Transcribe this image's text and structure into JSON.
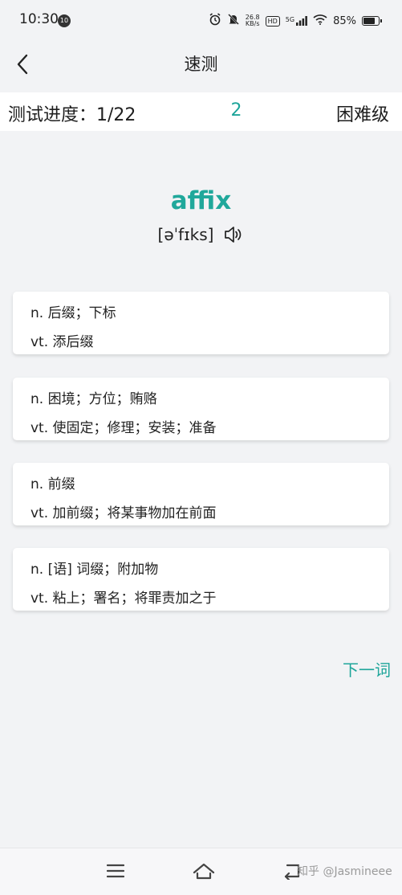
{
  "status_bar": {
    "time": "10:30",
    "notification_badge": "10",
    "net_speed_value": "26.8",
    "net_speed_unit": "KB/s",
    "hd_label": "HD",
    "network_label": "5G",
    "battery": "85%",
    "battery_level": 0.85
  },
  "header": {
    "title": "速测"
  },
  "progress": {
    "label": "测试进度：1/22",
    "correct_count": "2",
    "difficulty": "困难级"
  },
  "word": {
    "text": "affix",
    "phonetic": "[əˈfɪks]"
  },
  "options": [
    {
      "line1": "n. 后缀；下标",
      "line2": "vt. 添后缀"
    },
    {
      "line1": "n. 困境；方位；贿赂",
      "line2": "vt. 使固定；修理；安装；准备"
    },
    {
      "line1": "n. 前缀",
      "line2": "vt. 加前缀；将某事物加在前面"
    },
    {
      "line1": "n. [语] 词缀；附加物",
      "line2": "vt. 粘上；署名；将罪责加之于"
    }
  ],
  "next_label": "下一词",
  "watermark": "知乎 @Jasmineee",
  "colors": {
    "accent": "#1ea59a",
    "background": "#f2f3f5",
    "card": "#ffffff"
  }
}
